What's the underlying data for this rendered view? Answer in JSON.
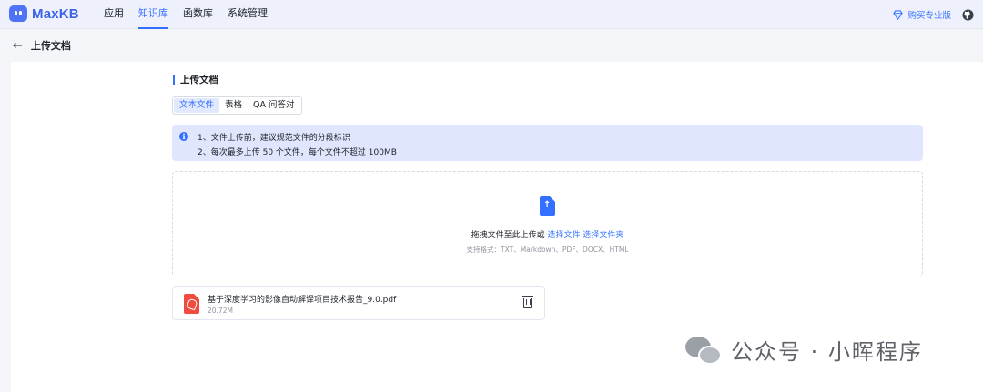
{
  "app": {
    "name": "MaxKB"
  },
  "nav": {
    "items": [
      {
        "label": "应用",
        "active": false
      },
      {
        "label": "知识库",
        "active": true
      },
      {
        "label": "函数库",
        "active": false
      },
      {
        "label": "系统管理",
        "active": false
      }
    ],
    "upgrade_label": "购买专业版"
  },
  "page": {
    "title": "上传文档"
  },
  "section": {
    "title": "上传文档"
  },
  "tabs": [
    {
      "label": "文本文件",
      "active": true
    },
    {
      "label": "表格",
      "active": false
    },
    {
      "label": "QA 问答对",
      "active": false
    }
  ],
  "alert": {
    "lines": [
      "1、文件上传前，建议规范文件的分段标识",
      "2、每次最多上传 50 个文件，每个文件不超过 100MB"
    ]
  },
  "dropzone": {
    "text": "拖拽文件至此上传或",
    "select_file": "选择文件",
    "select_folder": "选择文件夹",
    "hint": "支持格式：TXT、Markdown、PDF、DOCX、HTML"
  },
  "files": [
    {
      "name": "基于深度学习的影像自动解译项目技术报告_9.0.pdf",
      "size": "20.72M"
    }
  ],
  "watermark": {
    "text": "公众号 · 小晖程序"
  },
  "colors": {
    "accent": "#3370ff",
    "alert_bg": "#dfe6fd",
    "pdf": "#f04b3e"
  }
}
